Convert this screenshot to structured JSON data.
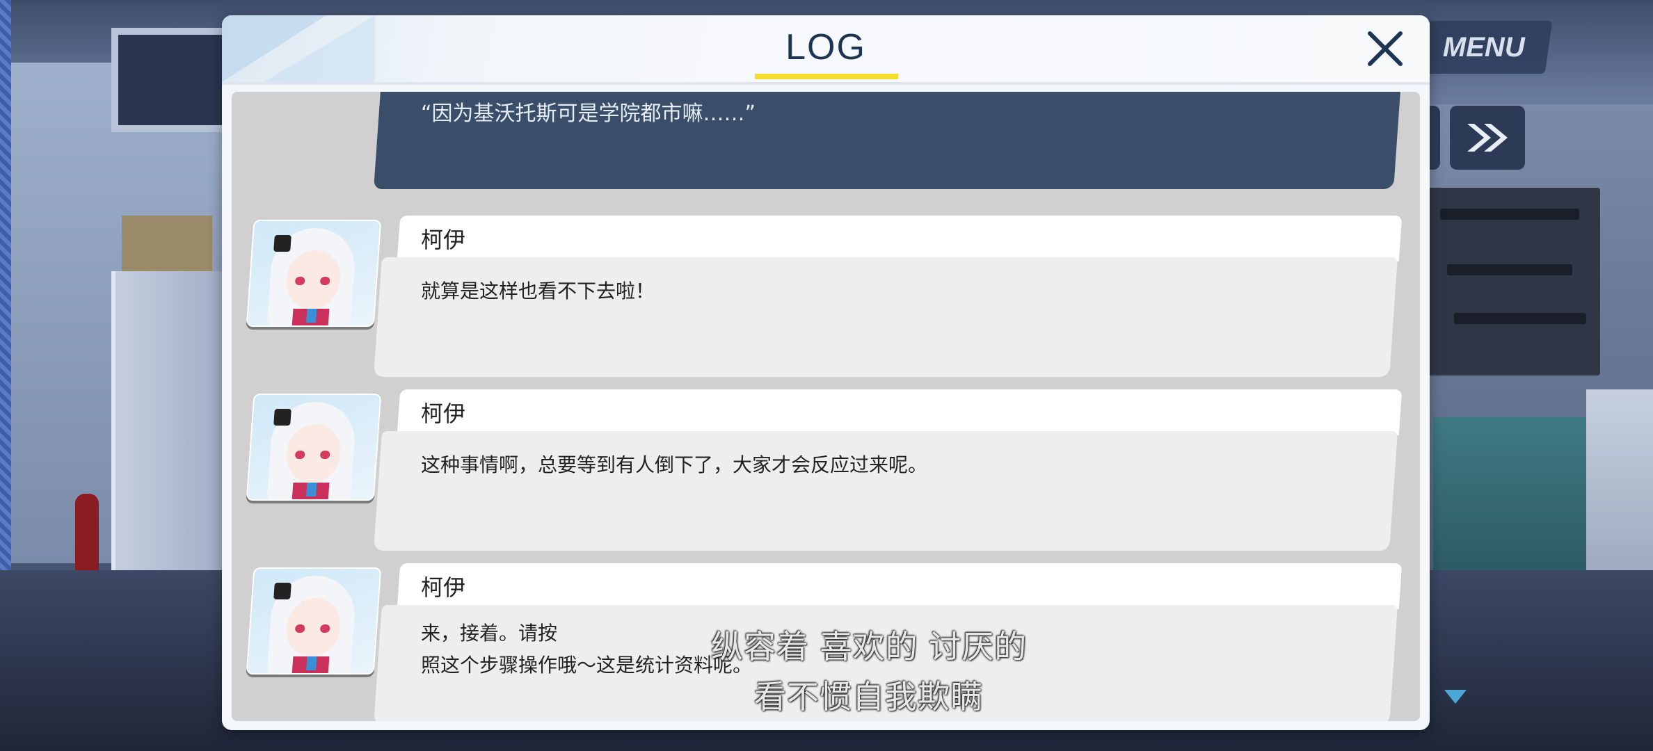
{
  "hud": {
    "menu_label": "MENU"
  },
  "log": {
    "title": "LOG",
    "previous_line": "“因为基沃托斯可是学院都市嘛……”",
    "entries": [
      {
        "speaker": "柯伊",
        "text": "就算是这样也看不下去啦！"
      },
      {
        "speaker": "柯伊",
        "text": "这种事情啊，总要等到有人倒下了，大家才会反应过来呢。"
      },
      {
        "speaker": "柯伊",
        "text": "来，接着。请按\n照这个步骤操作哦～这是统计资料呢。"
      }
    ]
  },
  "subtitles": {
    "line1": "纵容着 喜欢的 讨厌的",
    "line2": "看不惯自我欺瞒"
  },
  "colors": {
    "accent_underline": "#f3dc2c",
    "header_text": "#1d3553",
    "prev_bubble": "#3a4e6a"
  }
}
